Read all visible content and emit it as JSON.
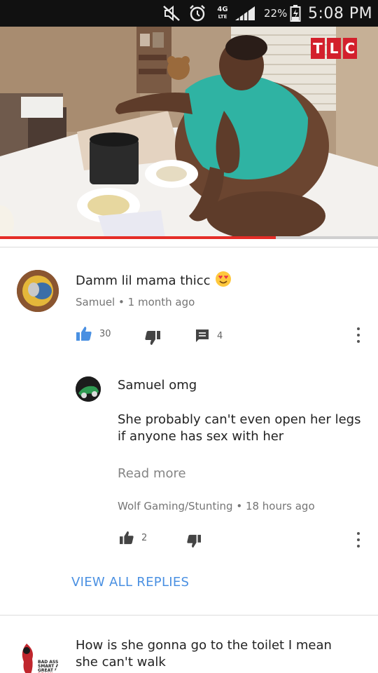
{
  "status_bar": {
    "network": "4G",
    "network_sub": "LTE",
    "battery_percent": "22%",
    "time": "5:08 PM"
  },
  "video": {
    "channel_logo_letters": [
      "T",
      "L",
      "C"
    ],
    "progress": 0.73,
    "colors": {
      "progress": "#e52d27",
      "logo": "#d3202c"
    }
  },
  "comments": [
    {
      "text": "Damm lil mama thicc",
      "emoji": "smiling-face-with-heart-eyes",
      "author": "Samuel",
      "time": "1 month ago",
      "likes": "30",
      "replies": "4"
    }
  ],
  "reply": {
    "title": "Samuel omg",
    "text_line1": "She probably can't even open her legs",
    "text_line2": "if anyone has sex with her",
    "read_more": "Read more",
    "author": "Wolf Gaming/Stunting",
    "time": "18 hours ago",
    "likes": "2"
  },
  "view_all_replies": "VIEW ALL REPLIES",
  "next_comment": {
    "line1": "How is she gonna go to the toilet I mean",
    "line2": "she can't walk",
    "avatar_text": "BAD ASS. SMART A' GREAT R' BEAMI"
  },
  "accent_color": "#4a90e2"
}
